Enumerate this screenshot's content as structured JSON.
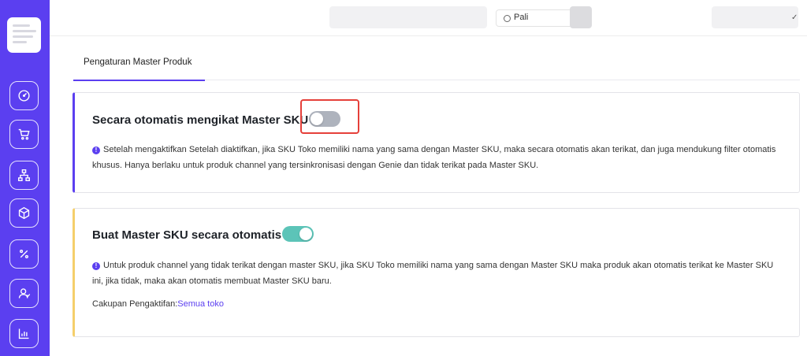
{
  "sidebar": {
    "icons": [
      "dashboard-icon",
      "cart-icon",
      "hierarchy-icon",
      "box-icon",
      "percent-icon",
      "users-icon",
      "chart-icon"
    ]
  },
  "topbar": {
    "store_select": "Pali",
    "checkmark": "✓"
  },
  "tabs": [
    {
      "label": "Pengaturan Master Produk",
      "active": true
    }
  ],
  "card1": {
    "title": "Secara otomatis mengikat Master SKU",
    "toggle_on": false,
    "info_icon": "!",
    "description": "Setelah mengaktifkan Setelah diaktifkan, jika SKU Toko memiliki nama yang sama dengan Master SKU, maka secara otomatis akan terikat, dan juga mendukung filter otomatis khusus. Hanya berlaku untuk produk channel yang tersinkronisasi dengan Genie dan tidak terikat pada Master SKU."
  },
  "card2": {
    "title": "Buat Master SKU secara otomatis",
    "toggle_on": true,
    "info_icon": "!",
    "description": "Untuk produk channel yang tidak terikat dengan master SKU, jika SKU Toko memiliki nama yang sama dengan Master SKU maka produk akan otomatis terikat ke Master SKU ini, jika tidak, maka akan otomatis membuat Master SKU baru.",
    "scope_label": "Cakupan Pengaktifan:",
    "scope_value": "Semua toko"
  },
  "colors": {
    "accent": "#5b3ff0",
    "toggle_on": "#5cc4b8",
    "toggle_off": "#aeb3bd",
    "highlight": "#e5403a",
    "card2_border": "#f5cf6b"
  }
}
